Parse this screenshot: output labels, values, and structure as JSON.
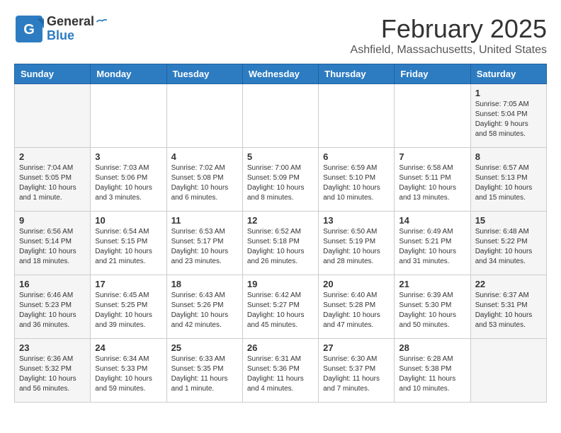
{
  "header": {
    "logo_line1": "General",
    "logo_line2": "Blue",
    "month_title": "February 2025",
    "location": "Ashfield, Massachusetts, United States"
  },
  "days_of_week": [
    "Sunday",
    "Monday",
    "Tuesday",
    "Wednesday",
    "Thursday",
    "Friday",
    "Saturday"
  ],
  "weeks": [
    [
      {
        "day": "",
        "info": ""
      },
      {
        "day": "",
        "info": ""
      },
      {
        "day": "",
        "info": ""
      },
      {
        "day": "",
        "info": ""
      },
      {
        "day": "",
        "info": ""
      },
      {
        "day": "",
        "info": ""
      },
      {
        "day": "1",
        "info": "Sunrise: 7:05 AM\nSunset: 5:04 PM\nDaylight: 9 hours and 58 minutes."
      }
    ],
    [
      {
        "day": "2",
        "info": "Sunrise: 7:04 AM\nSunset: 5:05 PM\nDaylight: 10 hours and 1 minute."
      },
      {
        "day": "3",
        "info": "Sunrise: 7:03 AM\nSunset: 5:06 PM\nDaylight: 10 hours and 3 minutes."
      },
      {
        "day": "4",
        "info": "Sunrise: 7:02 AM\nSunset: 5:08 PM\nDaylight: 10 hours and 6 minutes."
      },
      {
        "day": "5",
        "info": "Sunrise: 7:00 AM\nSunset: 5:09 PM\nDaylight: 10 hours and 8 minutes."
      },
      {
        "day": "6",
        "info": "Sunrise: 6:59 AM\nSunset: 5:10 PM\nDaylight: 10 hours and 10 minutes."
      },
      {
        "day": "7",
        "info": "Sunrise: 6:58 AM\nSunset: 5:11 PM\nDaylight: 10 hours and 13 minutes."
      },
      {
        "day": "8",
        "info": "Sunrise: 6:57 AM\nSunset: 5:13 PM\nDaylight: 10 hours and 15 minutes."
      }
    ],
    [
      {
        "day": "9",
        "info": "Sunrise: 6:56 AM\nSunset: 5:14 PM\nDaylight: 10 hours and 18 minutes."
      },
      {
        "day": "10",
        "info": "Sunrise: 6:54 AM\nSunset: 5:15 PM\nDaylight: 10 hours and 21 minutes."
      },
      {
        "day": "11",
        "info": "Sunrise: 6:53 AM\nSunset: 5:17 PM\nDaylight: 10 hours and 23 minutes."
      },
      {
        "day": "12",
        "info": "Sunrise: 6:52 AM\nSunset: 5:18 PM\nDaylight: 10 hours and 26 minutes."
      },
      {
        "day": "13",
        "info": "Sunrise: 6:50 AM\nSunset: 5:19 PM\nDaylight: 10 hours and 28 minutes."
      },
      {
        "day": "14",
        "info": "Sunrise: 6:49 AM\nSunset: 5:21 PM\nDaylight: 10 hours and 31 minutes."
      },
      {
        "day": "15",
        "info": "Sunrise: 6:48 AM\nSunset: 5:22 PM\nDaylight: 10 hours and 34 minutes."
      }
    ],
    [
      {
        "day": "16",
        "info": "Sunrise: 6:46 AM\nSunset: 5:23 PM\nDaylight: 10 hours and 36 minutes."
      },
      {
        "day": "17",
        "info": "Sunrise: 6:45 AM\nSunset: 5:25 PM\nDaylight: 10 hours and 39 minutes."
      },
      {
        "day": "18",
        "info": "Sunrise: 6:43 AM\nSunset: 5:26 PM\nDaylight: 10 hours and 42 minutes."
      },
      {
        "day": "19",
        "info": "Sunrise: 6:42 AM\nSunset: 5:27 PM\nDaylight: 10 hours and 45 minutes."
      },
      {
        "day": "20",
        "info": "Sunrise: 6:40 AM\nSunset: 5:28 PM\nDaylight: 10 hours and 47 minutes."
      },
      {
        "day": "21",
        "info": "Sunrise: 6:39 AM\nSunset: 5:30 PM\nDaylight: 10 hours and 50 minutes."
      },
      {
        "day": "22",
        "info": "Sunrise: 6:37 AM\nSunset: 5:31 PM\nDaylight: 10 hours and 53 minutes."
      }
    ],
    [
      {
        "day": "23",
        "info": "Sunrise: 6:36 AM\nSunset: 5:32 PM\nDaylight: 10 hours and 56 minutes."
      },
      {
        "day": "24",
        "info": "Sunrise: 6:34 AM\nSunset: 5:33 PM\nDaylight: 10 hours and 59 minutes."
      },
      {
        "day": "25",
        "info": "Sunrise: 6:33 AM\nSunset: 5:35 PM\nDaylight: 11 hours and 1 minute."
      },
      {
        "day": "26",
        "info": "Sunrise: 6:31 AM\nSunset: 5:36 PM\nDaylight: 11 hours and 4 minutes."
      },
      {
        "day": "27",
        "info": "Sunrise: 6:30 AM\nSunset: 5:37 PM\nDaylight: 11 hours and 7 minutes."
      },
      {
        "day": "28",
        "info": "Sunrise: 6:28 AM\nSunset: 5:38 PM\nDaylight: 11 hours and 10 minutes."
      },
      {
        "day": "",
        "info": ""
      }
    ]
  ]
}
